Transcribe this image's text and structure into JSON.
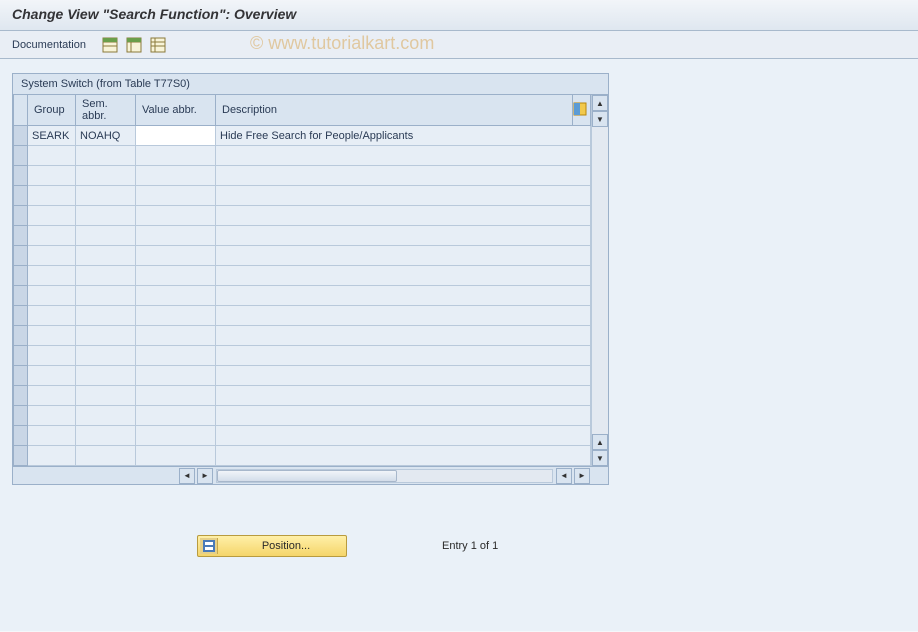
{
  "header": {
    "title": "Change View \"Search Function\": Overview"
  },
  "toolbar": {
    "documentation_label": "Documentation"
  },
  "watermark": "© www.tutorialkart.com",
  "table": {
    "title": "System Switch (from Table T77S0)",
    "columns": {
      "group": "Group",
      "sem_abbr": "Sem. abbr.",
      "value_abbr": "Value abbr.",
      "description": "Description"
    },
    "rows": [
      {
        "group": "SEARK",
        "sem_abbr": "NOAHQ",
        "value_abbr": "",
        "description": "Hide Free Search for People/Applicants"
      }
    ]
  },
  "footer": {
    "position_label": "Position...",
    "entry_text": "Entry 1 of 1"
  }
}
